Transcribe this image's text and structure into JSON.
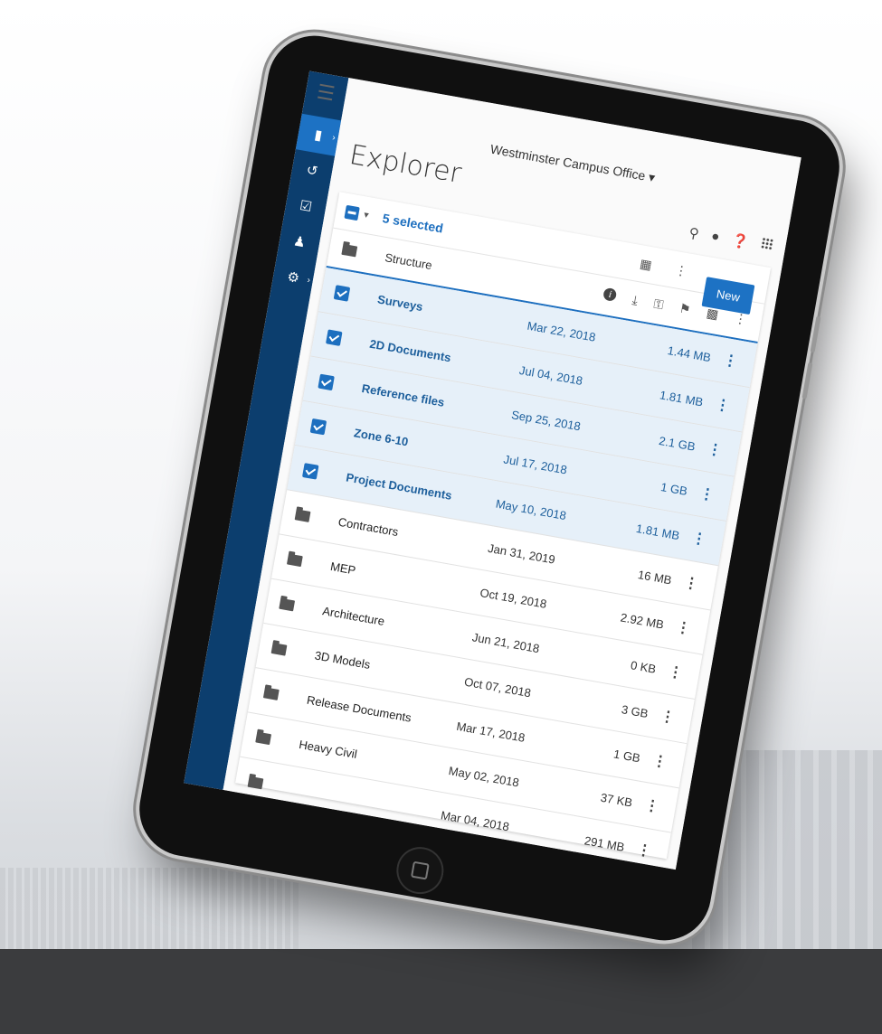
{
  "app": {
    "office": "Westminster Campus Office",
    "title": "Explorer",
    "selection_text": "5 selected",
    "new_label": "New",
    "header_folder": "Structure"
  },
  "sidebar": [
    {
      "icon": "folder-icon",
      "active": true
    },
    {
      "icon": "history-icon",
      "active": false
    },
    {
      "icon": "clipboard-icon",
      "active": false
    },
    {
      "icon": "people-icon",
      "active": false
    },
    {
      "icon": "gear-icon",
      "active": false
    }
  ],
  "rows": [
    {
      "name": "Surveys",
      "date": "Mar 22, 2018",
      "size": "1.44 MB",
      "selected": true
    },
    {
      "name": "2D Documents",
      "date": "Jul 04, 2018",
      "size": "1.81 MB",
      "selected": true
    },
    {
      "name": "Reference files",
      "date": "Sep 25, 2018",
      "size": "2.1 GB",
      "selected": true
    },
    {
      "name": "Zone 6-10",
      "date": "Jul 17, 2018",
      "size": "1 GB",
      "selected": true
    },
    {
      "name": "Project Documents",
      "date": "May 10, 2018",
      "size": "1.81 MB",
      "selected": true
    },
    {
      "name": "Contractors",
      "date": "Jan 31, 2019",
      "size": "16 MB",
      "selected": false
    },
    {
      "name": "MEP",
      "date": "Oct 19, 2018",
      "size": "2.92 MB",
      "selected": false
    },
    {
      "name": "Architecture",
      "date": "Jun 21, 2018",
      "size": "0 KB",
      "selected": false
    },
    {
      "name": "3D Models",
      "date": "Oct 07, 2018",
      "size": "3 GB",
      "selected": false
    },
    {
      "name": "Release Documents",
      "date": "Mar 17, 2018",
      "size": "1 GB",
      "selected": false
    },
    {
      "name": "Heavy Civil",
      "date": "May 02, 2018",
      "size": "37 KB",
      "selected": false
    },
    {
      "name": "",
      "date": "Mar 04, 2018",
      "size": "291 MB",
      "selected": false
    }
  ]
}
